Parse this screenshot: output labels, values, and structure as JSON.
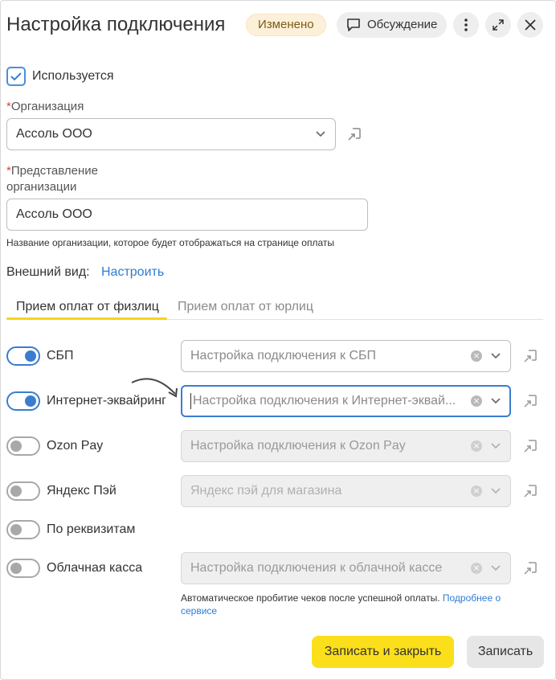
{
  "header": {
    "title": "Настройка подключения",
    "status_badge": "Изменено",
    "discussion_label": "Обсуждение"
  },
  "used_checkbox": {
    "label": "Используется",
    "checked": true
  },
  "organization": {
    "label": "Организация",
    "required_mark": "*",
    "value": "Ассоль ООО"
  },
  "org_presentation": {
    "label_line1": "Представление",
    "label_line2": "организации",
    "required_mark": "*",
    "value": "Ассоль ООО",
    "hint": "Название организации, которое будет отображаться на странице оплаты"
  },
  "appearance": {
    "label": "Внешний вид:",
    "link": "Настроить"
  },
  "tabs": [
    {
      "label": "Прием оплат от физлиц",
      "active": true
    },
    {
      "label": "Прием оплат от юрлиц",
      "active": false
    }
  ],
  "payment_methods": [
    {
      "label": "СБП",
      "enabled": true,
      "field_value": "Настройка подключения к СБП",
      "field_state": "placeholder"
    },
    {
      "label": "Интернет-эквайринг",
      "enabled": true,
      "field_value": "Настройка подключения к Интернет-эквай...",
      "field_state": "focused"
    },
    {
      "label": "Ozon Pay",
      "enabled": false,
      "field_value": "Настройка подключения к Ozon Pay",
      "field_state": "disabled"
    },
    {
      "label": "Яндекс Пэй",
      "enabled": false,
      "field_value": "Яндекс пэй для магазина",
      "field_state": "disabled"
    },
    {
      "label": "По реквизитам",
      "enabled": false
    },
    {
      "label": "Облачная касса",
      "enabled": false,
      "field_value": "Настройка подключения к облачной кассе",
      "field_state": "disabled"
    }
  ],
  "cloud_hint": {
    "text": "Автоматическое пробитие чеков после успешной оплаты.",
    "link_line1": "Подробнее о",
    "link_line2": "сервисе"
  },
  "footer": {
    "save_close_label": "Записать и закрыть",
    "save_label": "Записать"
  },
  "colors": {
    "accent_blue": "#3a7dd0",
    "primary_yellow": "#fbdf1a",
    "badge_bg": "#fdf0da",
    "required_red": "#e34141"
  }
}
